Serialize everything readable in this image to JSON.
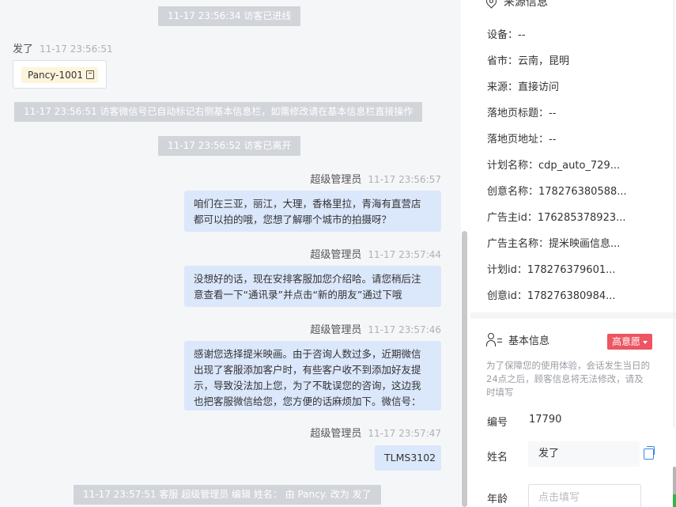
{
  "chat": {
    "system_messages": [
      "11-17 23:56:34 访客已进线",
      "11-17 23:56:51 访客微信号已自动标记右侧基本信息栏，如需修改请在基本信息栏直接操作",
      "11-17 23:56:52 访客已离开",
      "11-17 23:57:51 客服 超级管理员 编辑 姓名： 由 Pancy. 改为 发了"
    ],
    "visitor_message": {
      "sender": "发了",
      "time": "11-17 23:56:51",
      "tag": "Pancy-1001"
    },
    "agent_messages": [
      {
        "sender": "超级管理员",
        "time": "11-17 23:56:57",
        "lines": [
          "咱们在三亚，丽江，大理，香格里拉，青海有直营店",
          "都可以拍的哦，您想了解哪个城市的拍摄呀？"
        ]
      },
      {
        "sender": "超级管理员",
        "time": "11-17 23:57:44",
        "lines": [
          "没想好的话，现在安排客服加您介绍哈。请您稍后注",
          "意查看一下“通讯录”并点击“新的朋友”通过下哦"
        ]
      },
      {
        "sender": "超级管理员",
        "time": "11-17 23:57:46",
        "lines": [
          "感谢您选择提米映画。由于咨询人数过多，近期微信",
          "出现了客服添加客户时，有些客户收不到添加好友提",
          "示，导致没法加上您，为了不耽误您的咨询，这边我",
          "也把客服微信给您，您方便的话麻烦加下。微信号："
        ]
      },
      {
        "sender": "超级管理员",
        "time": "11-17 23:57:47",
        "lines": [
          "TLMS3102"
        ]
      }
    ]
  },
  "source_info": {
    "title": "来源信息",
    "rows": [
      "设备：--",
      "省市：云南，昆明",
      "来源：直接访问",
      "落地页标题：--",
      "落地页地址：--",
      "计划名称：cdp_auto_729...",
      "创意名称：178276380588...",
      "广告主id：176285378923...",
      "广告主名称：提米映画信息...",
      "计划id：178276379601...",
      "创意id：178276380984..."
    ]
  },
  "basic_info": {
    "title": "基本信息",
    "badge": "高意愿",
    "hint": "为了保障您的使用体验，会话发生当日的24点之后，顾客信息将无法修改，请及时填写",
    "id_label": "编号",
    "id_value": "17790",
    "name_label": "姓名",
    "name_value": "发了",
    "age_label": "年龄",
    "age_placeholder": "点击填写"
  },
  "icons": [
    "pin-icon",
    "user-info-icon",
    "copy-icon",
    "caret-down-icon"
  ],
  "colors": {
    "agent_bubble": "#dbe7fb",
    "badge": "#ec5561",
    "accent": "#3a86e8",
    "system": "#d1d4d9"
  }
}
